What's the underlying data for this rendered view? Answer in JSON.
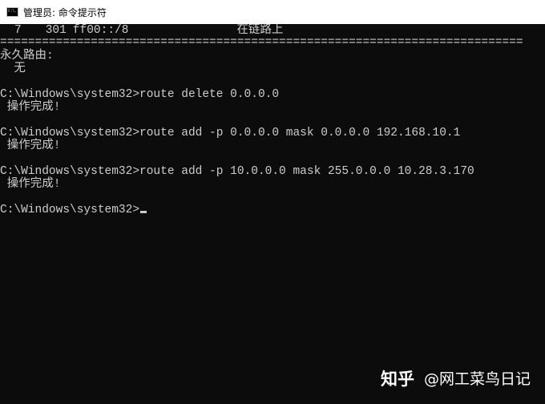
{
  "window": {
    "title": "管理员: 命令提示符",
    "icon": "cmd-icon",
    "icon_text": "C:\\."
  },
  "console": {
    "route_row": {
      "index": "7",
      "metric": "301",
      "destination": "ff00::/8",
      "gateway": "在链路上"
    },
    "separator": "===========================================================================",
    "persistent_header": "永久路由:",
    "persistent_value": "  无",
    "commands": [
      {
        "prompt": "C:\\Windows\\system32>",
        "command": "route delete 0.0.0.0",
        "output": " 操作完成!"
      },
      {
        "prompt": "C:\\Windows\\system32>",
        "command": "route add -p 0.0.0.0 mask 0.0.0.0 192.168.10.1",
        "output": " 操作完成!"
      },
      {
        "prompt": "C:\\Windows\\system32>",
        "command": "route add -p 10.0.0.0 mask 255.0.0.0 10.28.3.170",
        "output": " 操作完成!"
      }
    ],
    "final_prompt": "C:\\Windows\\system32>"
  },
  "watermark": {
    "logo": "知乎",
    "handle": "@网工菜鸟日记"
  }
}
